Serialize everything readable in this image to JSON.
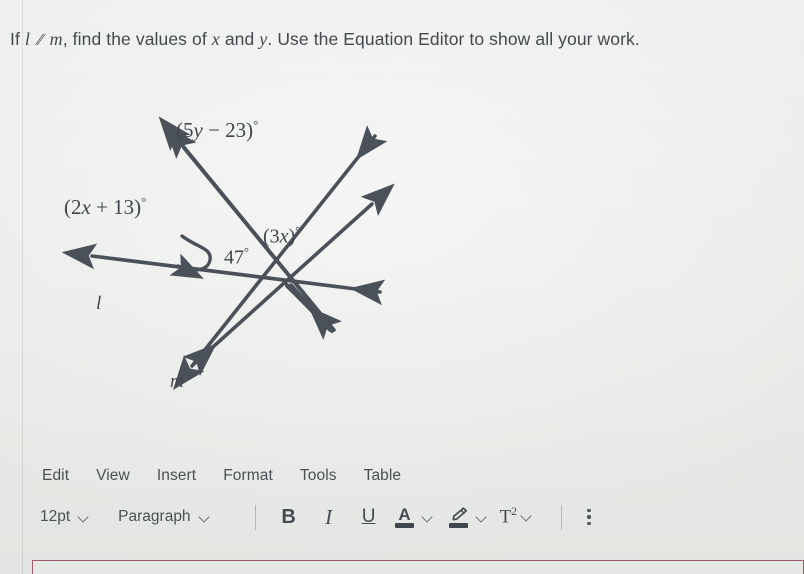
{
  "prompt": {
    "lead": "If",
    "line_l": "l",
    "parallel_symbol": "∕∕",
    "line_m": "m",
    "mid": ", find the values of",
    "var_x": "x",
    "and": "and",
    "var_y": "y",
    "tail": ".  Use the Equation Editor to show all your work."
  },
  "figure": {
    "labels": {
      "angle_5y": "(5y − 23)",
      "angle_5y_unit": "°",
      "angle_2x": "(2x + 13)",
      "angle_2x_unit": "°",
      "angle_3x": "(3x)",
      "angle_3x_unit": "°",
      "angle_47": "47",
      "angle_47_unit": "°",
      "line_l": "l",
      "line_m": "m"
    },
    "stroke_color": "#4a5158"
  },
  "editor": {
    "menubar": [
      {
        "label": "Edit"
      },
      {
        "label": "View"
      },
      {
        "label": "Insert"
      },
      {
        "label": "Format"
      },
      {
        "label": "Tools"
      },
      {
        "label": "Table"
      }
    ],
    "toolbar": {
      "font_size": "12pt",
      "block_format": "Paragraph",
      "bold": "B",
      "italic": "I",
      "underline": "U",
      "text_color_glyph": "A",
      "highlight_glyph": "✎",
      "superscript_glyph": "T",
      "superscript_exponent": "2",
      "more_options": "⋮"
    }
  },
  "colors": {
    "background": "#e9ebe9",
    "ink": "#43494e",
    "textarea_border": "#9d5a68"
  }
}
